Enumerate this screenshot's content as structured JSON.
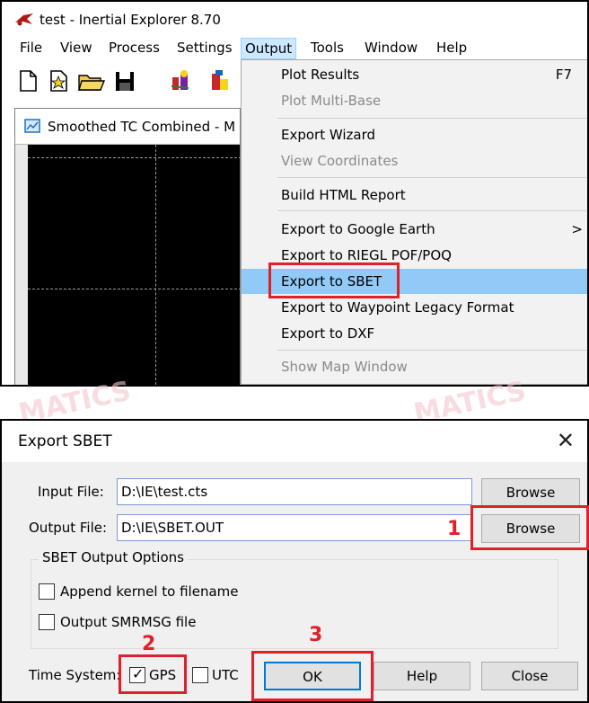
{
  "app": {
    "title": "test - Inertial Explorer 8.70",
    "menu": [
      "File",
      "View",
      "Process",
      "Settings",
      "Output",
      "Tools",
      "Window",
      "Help"
    ],
    "active_menu": "Output",
    "child_window_title": "Smoothed TC Combined - M"
  },
  "toolbar_icons": [
    "new-file-icon",
    "new-project-icon",
    "open-folder-icon",
    "save-icon",
    "process-icon",
    "process-alt-icon"
  ],
  "output_menu": {
    "items": [
      {
        "label": "Plot Results",
        "shortcut": "F7",
        "enabled": true
      },
      {
        "label": "Plot Multi-Base",
        "enabled": false
      },
      {
        "label": "Export Wizard",
        "enabled": true
      },
      {
        "label": "View Coordinates",
        "enabled": false
      },
      {
        "label": "Build HTML Report",
        "enabled": true
      },
      {
        "label": "Export to Google Earth",
        "submenu": true,
        "enabled": true
      },
      {
        "label": "Export to RIEGL POF/POQ",
        "enabled": true
      },
      {
        "label": "Export to SBET",
        "enabled": true,
        "selected": true
      },
      {
        "label": "Export to Waypoint Legacy Format",
        "enabled": true
      },
      {
        "label": "Export to DXF",
        "enabled": true
      },
      {
        "label": "Show Map Window",
        "enabled": false
      }
    ],
    "submenu_arrow": ">"
  },
  "watermark": "MATICS",
  "dialog": {
    "title": "Export SBET",
    "close_glyph": "X",
    "input_file_label": "Input File:",
    "input_file_value": "D:\\IE\\test.cts",
    "output_file_label": "Output File:",
    "output_file_value": "D:\\IE\\SBET.OUT",
    "browse_label": "Browse",
    "options_group_label": "SBET Output Options",
    "append_kernel_label": "Append kernel to filename",
    "append_kernel_checked": false,
    "output_smrmsg_label": "Output SMRMSG file",
    "output_smrmsg_checked": false,
    "time_system_label": "Time System:",
    "gps_label": "GPS",
    "gps_checked": true,
    "utc_label": "UTC",
    "utc_checked": false,
    "ok_label": "OK",
    "help_label": "Help",
    "close_label": "Close"
  },
  "annotations": {
    "step1": "1",
    "step2": "2",
    "step3": "3",
    "highlight_color": "#e0202a"
  },
  "colors": {
    "menu_highlight": "#91c9f7",
    "active_menu_bg": "#cce8ff"
  }
}
